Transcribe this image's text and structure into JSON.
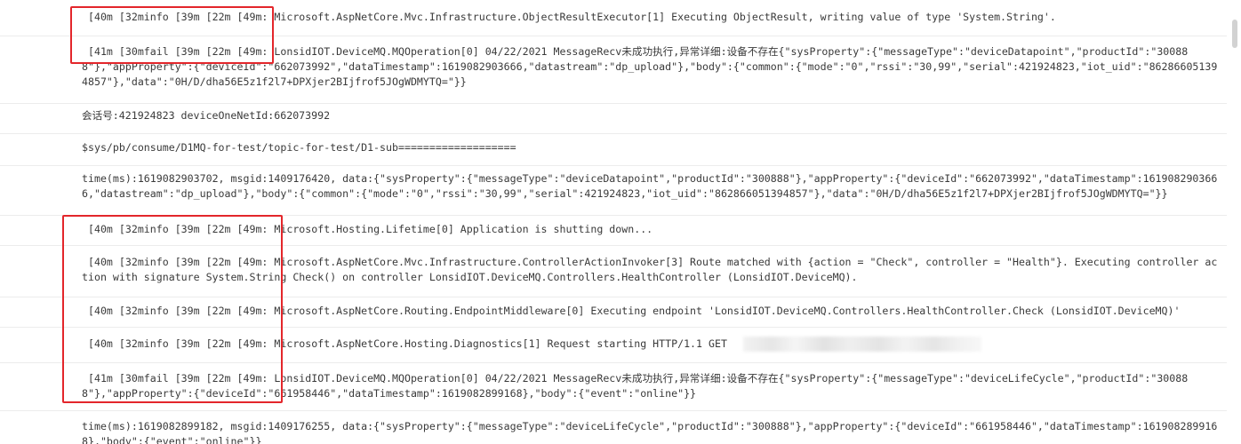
{
  "log": {
    "rows": [
      {
        "text": " [40m [32minfo [39m [22m [49m: Microsoft.AspNetCore.Mvc.Infrastructure.ObjectResultExecutor[1] Executing ObjectResult, writing value of type 'System.String'."
      },
      {
        "text": " [41m [30mfail [39m [22m [49m: LonsidIOT.DeviceMQ.MQOperation[0] 04/22/2021 MessageRecv未成功执行,异常详细:设备不存在{\"sysProperty\":{\"messageType\":\"deviceDatapoint\",\"productId\":\"300888\"},\"appProperty\":{\"deviceId\":\"662073992\",\"dataTimestamp\":1619082903666,\"datastream\":\"dp_upload\"},\"body\":{\"common\":{\"mode\":\"0\",\"rssi\":\"30,99\",\"serial\":421924823,\"iot_uid\":\"862866051394857\"},\"data\":\"0H/D/dha56E5z1f2l7+DPXjer2BIjfrof5JOgWDMYTQ=\"}}"
      },
      {
        "text": "会话号:421924823 deviceOneNetId:662073992"
      },
      {
        "text": "$sys/pb/consume/D1MQ-for-test/topic-for-test/D1-sub==================="
      },
      {
        "text": "time(ms):1619082903702, msgid:1409176420, data:{\"sysProperty\":{\"messageType\":\"deviceDatapoint\",\"productId\":\"300888\"},\"appProperty\":{\"deviceId\":\"662073992\",\"dataTimestamp\":1619082903666,\"datastream\":\"dp_upload\"},\"body\":{\"common\":{\"mode\":\"0\",\"rssi\":\"30,99\",\"serial\":421924823,\"iot_uid\":\"862866051394857\"},\"data\":\"0H/D/dha56E5z1f2l7+DPXjer2BIjfrof5JOgWDMYTQ=\"}}"
      },
      {
        "text": " [40m [32minfo [39m [22m [49m: Microsoft.Hosting.Lifetime[0] Application is shutting down..."
      },
      {
        "text": " [40m [32minfo [39m [22m [49m: Microsoft.AspNetCore.Mvc.Infrastructure.ControllerActionInvoker[3] Route matched with {action = \"Check\", controller = \"Health\"}. Executing controller action with signature System.String Check() on controller LonsidIOT.DeviceMQ.Controllers.HealthController (LonsidIOT.DeviceMQ)."
      },
      {
        "text": " [40m [32minfo [39m [22m [49m: Microsoft.AspNetCore.Routing.EndpointMiddleware[0] Executing endpoint 'LonsidIOT.DeviceMQ.Controllers.HealthController.Check (LonsidIOT.DeviceMQ)'"
      },
      {
        "text": " [40m [32minfo [39m [22m [49m: Microsoft.AspNetCore.Hosting.Diagnostics[1] Request starting HTTP/1.1 GET"
      },
      {
        "text": " [41m [30mfail [39m [22m [49m: LonsidIOT.DeviceMQ.MQOperation[0] 04/22/2021 MessageRecv未成功执行,异常详细:设备不存在{\"sysProperty\":{\"messageType\":\"deviceLifeCycle\",\"productId\":\"300888\"},\"appProperty\":{\"deviceId\":\"661958446\",\"dataTimestamp\":1619082899168},\"body\":{\"event\":\"online\"}}"
      },
      {
        "text": "time(ms):1619082899182, msgid:1409176255, data:{\"sysProperty\":{\"messageType\":\"deviceLifeCycle\",\"productId\":\"300888\"},\"appProperty\":{\"deviceId\":\"661958446\",\"dataTimestamp\":1619082899168},\"body\":{\"event\":\"online\"}}"
      }
    ]
  },
  "colors": {
    "highlight": "#e3262b",
    "row_border": "#ececec",
    "text": "#3a3a3a"
  }
}
